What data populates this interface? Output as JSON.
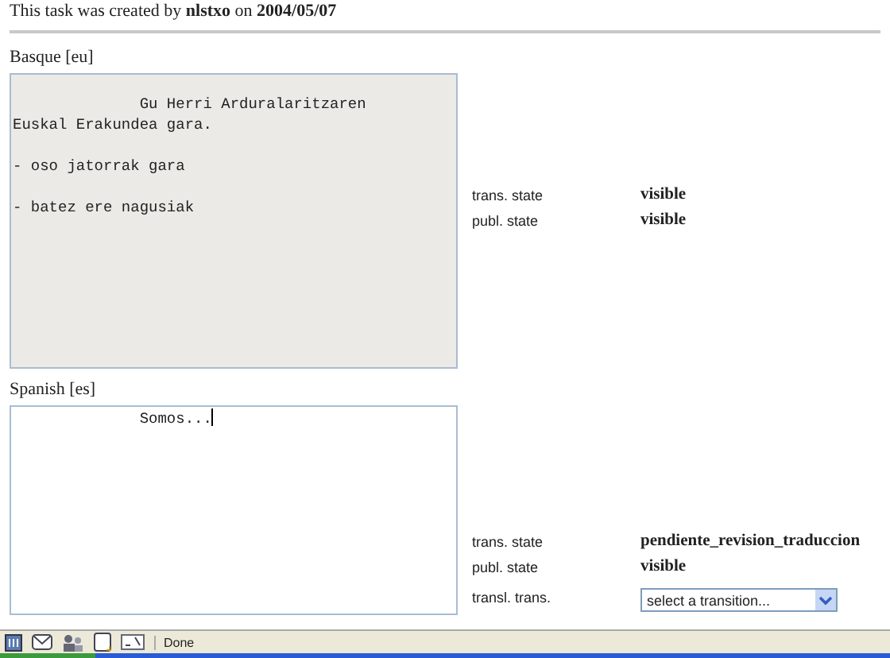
{
  "header": "This task was created by **nlstxo** on **2004/05/07**",
  "sections": [
    {
      "label": "Basque [eu]",
      "text": "              Gu Herri Arduralaritzaren\nEuskal Erakundea gara.\n\n- oso jatorrak gara\n\n- batez ere nagusiak",
      "editable": false,
      "states": [
        {
          "label": "trans. state",
          "value": "visible"
        },
        {
          "label": "publ. state",
          "value": "visible"
        }
      ]
    },
    {
      "label": "Spanish [es]",
      "text": "              Somos...",
      "editable": true,
      "states": [
        {
          "label": "trans. state",
          "value": "pendiente_revision_traduccion"
        },
        {
          "label": "publ. state",
          "value": "visible"
        }
      ],
      "transition": {
        "label": "transl. trans.",
        "value": "select a transition..."
      }
    }
  ],
  "status_bar": {
    "text": "Done"
  }
}
